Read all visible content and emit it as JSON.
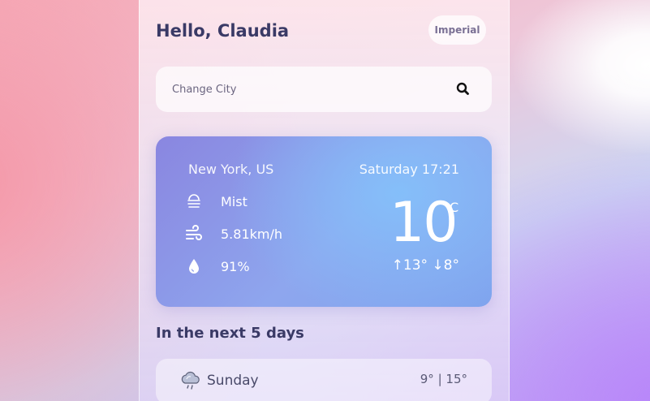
{
  "header": {
    "greeting": "Hello, Claudia",
    "unit_toggle_label": "Imperial"
  },
  "search": {
    "placeholder": "Change City",
    "icon": "search-icon"
  },
  "current": {
    "location": "New York, US",
    "datetime": "Saturday 17:21",
    "condition": "Mist",
    "condition_icon": "mist-icon",
    "wind": "5.81km/h",
    "wind_icon": "wind-icon",
    "humidity": "91%",
    "humidity_icon": "droplet-icon",
    "temperature": "10",
    "temperature_unit": "°C",
    "high_low": "↑13° ↓8°"
  },
  "forecast": {
    "title": "In the next 5 days",
    "days": [
      {
        "day": "Sunday",
        "range": "9° | 15°",
        "icon": "rain-cloud-icon"
      }
    ]
  },
  "colors": {
    "text_dark": "#3a3a66",
    "card_start": "#8a86e0",
    "card_end": "#7fa4ee"
  }
}
